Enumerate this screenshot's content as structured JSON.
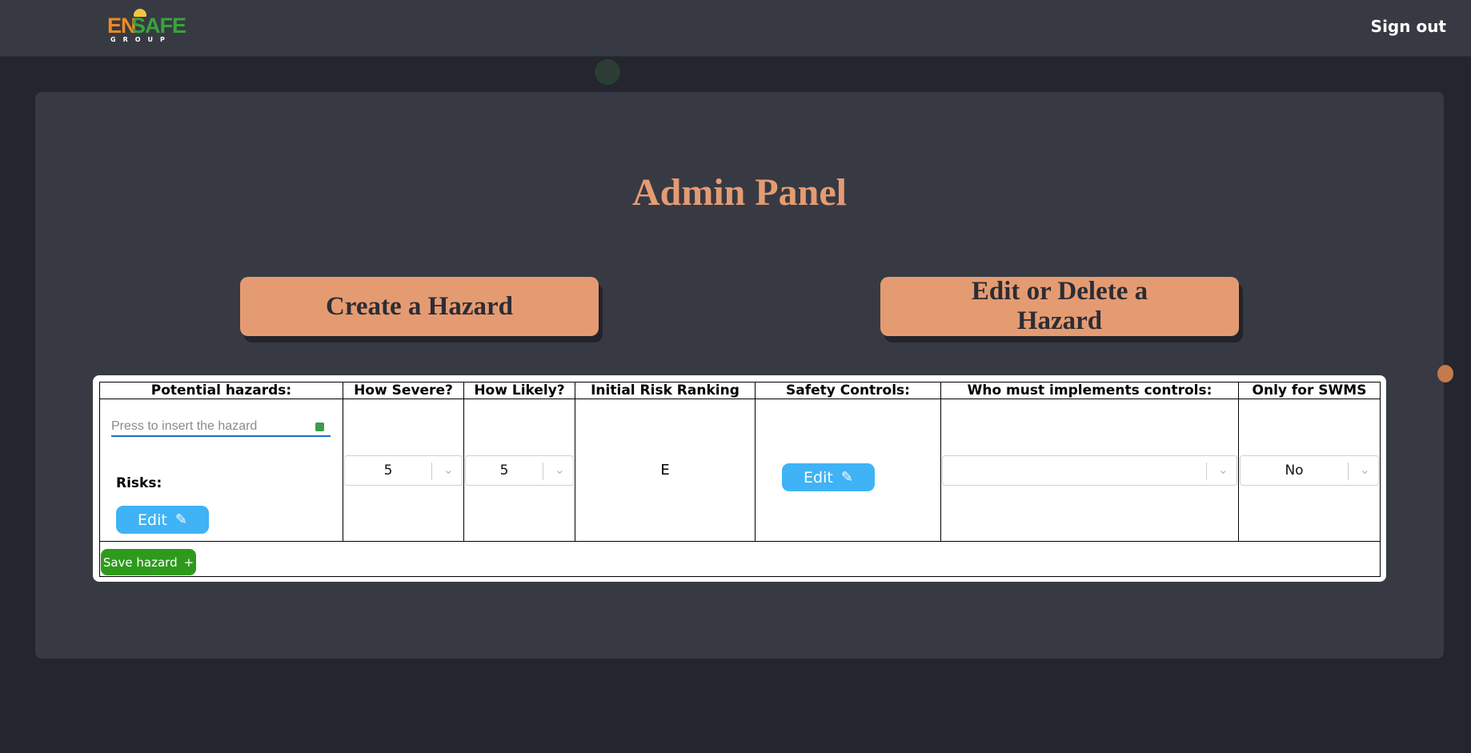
{
  "header": {
    "logo": {
      "part1": "EN",
      "part2": "SAFE",
      "sub": "GROUP"
    },
    "signout_label": "Sign out"
  },
  "panel": {
    "title": "Admin Panel",
    "create_label": "Create a Hazard",
    "edit_delete_label": "Edit or Delete a Hazard"
  },
  "table": {
    "headers": [
      "Potential hazards:",
      "How Severe?",
      "How Likely?",
      "Initial Risk Ranking",
      "Safety Controls:",
      "Who must implements controls:",
      "Only for SWMS"
    ],
    "hazard_placeholder": "Press to insert the hazard",
    "risks_label": "Risks:",
    "edit_label": "Edit",
    "severity_value": "5",
    "likelihood_value": "5",
    "risk_ranking": "E",
    "who_value": "",
    "swms_value": "No",
    "save_label": "Save hazard"
  },
  "icons": {
    "pencil": "pencil-icon",
    "plus": "plus-icon",
    "chevron": "chevron-down-icon"
  },
  "colors": {
    "accent": "#e59b72",
    "edit_button": "#3fb3f5",
    "save_button": "#2e9a1c",
    "background": "#24252e",
    "panel": "#373a43"
  }
}
